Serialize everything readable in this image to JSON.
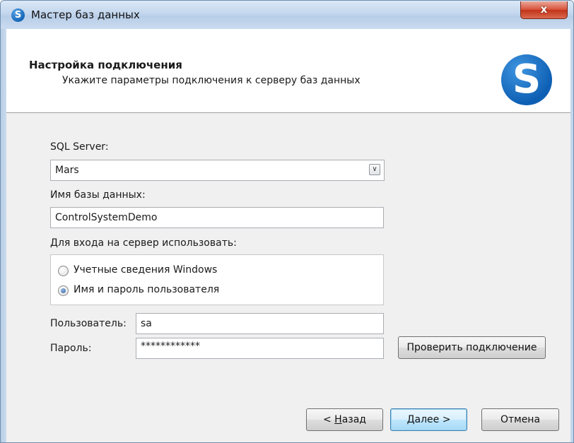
{
  "window": {
    "title": "Мастер баз данных",
    "close_label": "x"
  },
  "header": {
    "title": "Настройка подключения",
    "subtitle": "Укажите параметры подключения к серверу баз данных",
    "logo_icon": "app-logo-icon"
  },
  "form": {
    "server_label": "SQL Server:",
    "server_value": "Mars",
    "db_label": "Имя базы данных:",
    "db_value": "ControlSystemDemo",
    "auth_label": "Для входа на сервер использовать:",
    "auth_options": [
      {
        "label": "Учетные сведения Windows",
        "selected": false
      },
      {
        "label": "Имя и пароль пользователя",
        "selected": true
      }
    ],
    "user_label": "Пользователь:",
    "user_value": "sa",
    "password_label": "Пароль:",
    "password_value": "************",
    "test_button": "Проверить подключение"
  },
  "footer": {
    "back_key": "Н",
    "back_rest": "азад",
    "back_prefix": "< ",
    "next_key": "Д",
    "next_rest": "алее >",
    "cancel": "Отмена"
  },
  "colors": {
    "accent": "#1566b8",
    "close": "#c23418"
  }
}
